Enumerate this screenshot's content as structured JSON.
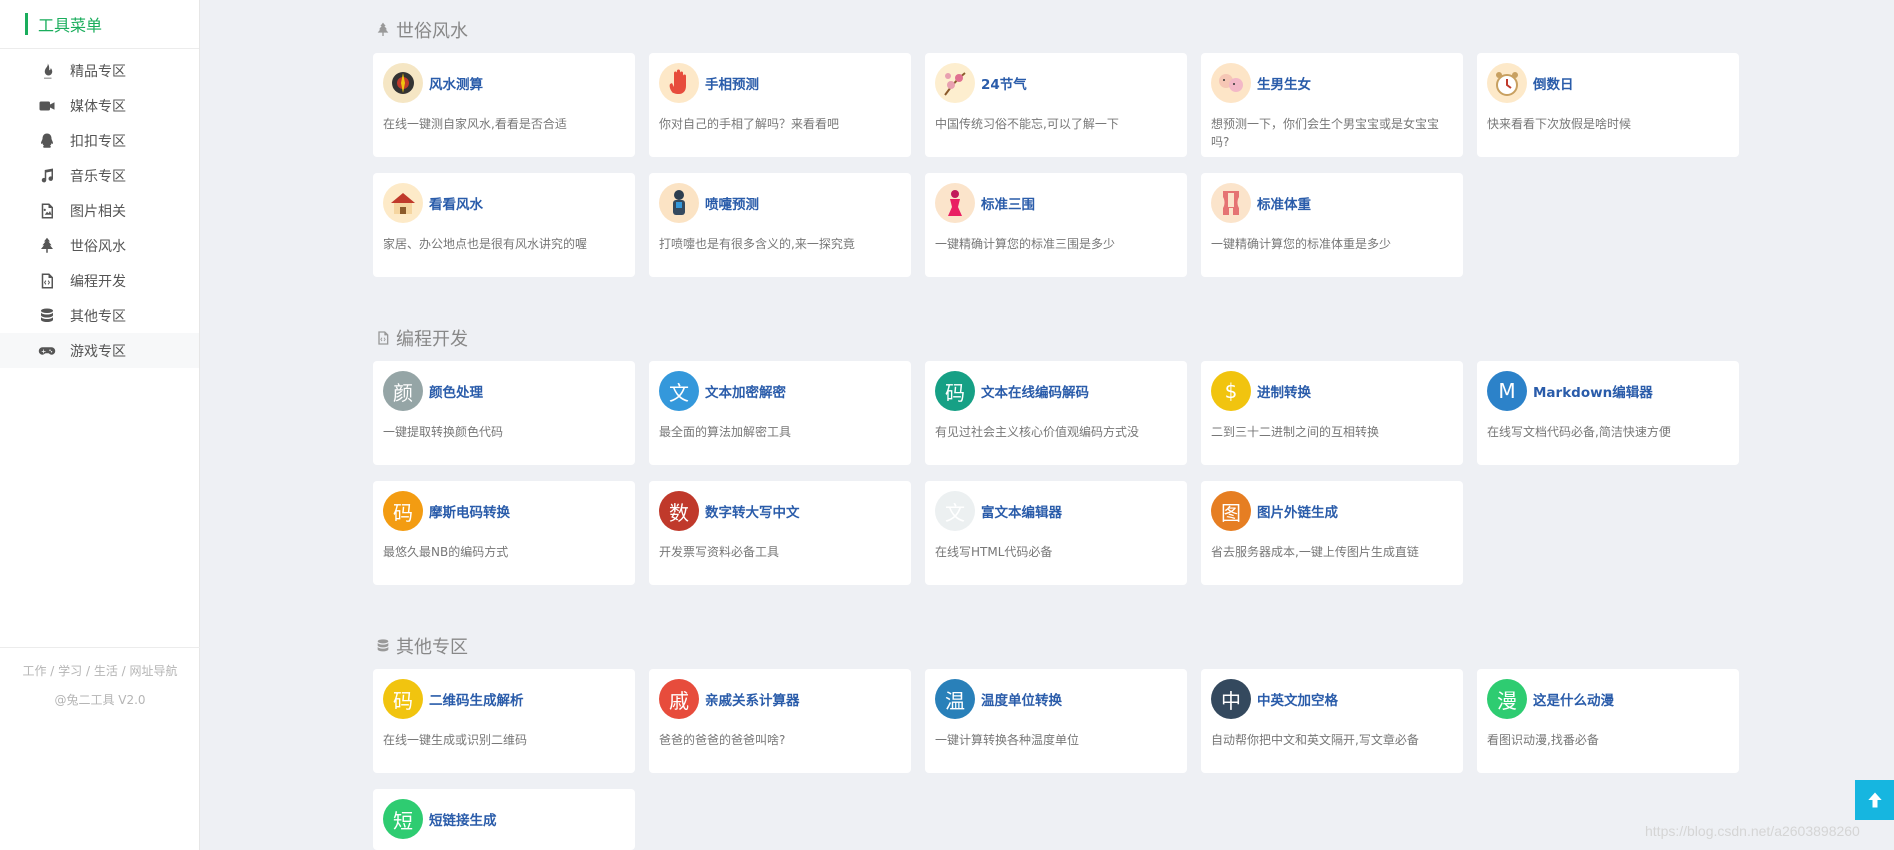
{
  "sidebar": {
    "title": "工具菜单",
    "items": [
      {
        "label": "精品专区",
        "icon": "fire-icon"
      },
      {
        "label": "媒体专区",
        "icon": "video-camera-icon"
      },
      {
        "label": "扣扣专区",
        "icon": "qq-icon"
      },
      {
        "label": "音乐专区",
        "icon": "music-note-icon"
      },
      {
        "label": "图片相关",
        "icon": "image-file-icon"
      },
      {
        "label": "世俗风水",
        "icon": "tree-icon"
      },
      {
        "label": "编程开发",
        "icon": "code-file-icon"
      },
      {
        "label": "其他专区",
        "icon": "database-icon"
      },
      {
        "label": "游戏专区",
        "icon": "gamepad-icon"
      }
    ],
    "footer": {
      "line1": "工作 / 学习 / 生活 / 网址导航",
      "line2": "@兔二工具 V2.0"
    }
  },
  "sections": [
    {
      "title": "世俗风水",
      "icon": "tree-icon",
      "cards": [
        {
          "name": "风水测算",
          "desc": "在线一键测自家风水,看看是否合适",
          "avatar_color": "#f5e6c4"
        },
        {
          "name": "手相预测",
          "desc": "你对自己的手相了解吗？来看看吧",
          "avatar_color": "#fde8c8"
        },
        {
          "name": "24节气",
          "desc": "中国传统习俗不能忘,可以了解一下",
          "avatar_color": "#fdeecf"
        },
        {
          "name": "生男生女",
          "desc": "想预测一下，你们会生个男宝宝或是女宝宝吗?",
          "avatar_color": "#fde5c7"
        },
        {
          "name": "倒数日",
          "desc": "快来看看下次放假是啥时候",
          "avatar_color": "#fde9c9"
        },
        {
          "name": "看看风水",
          "desc": "家居、办公地点也是很有风水讲究的喔",
          "avatar_color": "#fdeac8"
        },
        {
          "name": "喷嚏预测",
          "desc": "打喷嚏也是有很多含义的,来一探究竟",
          "avatar_color": "#fbe3c4"
        },
        {
          "name": "标准三围",
          "desc": "一键精确计算您的标准三围是多少",
          "avatar_color": "#fbe4cb"
        },
        {
          "name": "标准体重",
          "desc": "一键精确计算您的标准体重是多少",
          "avatar_color": "#fbe4cb"
        }
      ]
    },
    {
      "title": "编程开发",
      "icon": "code-file-icon",
      "cards": [
        {
          "name": "颜色处理",
          "desc": "一键提取转换颜色代码",
          "glyph": "颜",
          "avatar_color": "#95a5a6"
        },
        {
          "name": "文本加密解密",
          "desc": "最全面的算法加解密工具",
          "glyph": "文",
          "avatar_color": "#3498db"
        },
        {
          "name": "文本在线编码解码",
          "desc": "有见过社会主义核心价值观编码方式没",
          "glyph": "码",
          "avatar_color": "#16a085"
        },
        {
          "name": "进制转换",
          "desc": "二到三十二进制之间的互相转换",
          "glyph": "$",
          "avatar_color": "#f1c40f"
        },
        {
          "name": "Markdown编辑器",
          "desc": "在线写文档代码必备,简洁快速方便",
          "glyph": "M",
          "avatar_color": "#2c82c9"
        },
        {
          "name": "摩斯电码转换",
          "desc": "最悠久最NB的编码方式",
          "glyph": "码",
          "avatar_color": "#f39c12"
        },
        {
          "name": "数字转大写中文",
          "desc": "开发票写资料必备工具",
          "glyph": "数",
          "avatar_color": "#c0392b"
        },
        {
          "name": "富文本编辑器",
          "desc": "在线写HTML代码必备",
          "glyph": "文",
          "avatar_color": "#ecf0f1"
        },
        {
          "name": "图片外链生成",
          "desc": "省去服务器成本,一键上传图片生成直链",
          "glyph": "图",
          "avatar_color": "#e67e22"
        }
      ]
    },
    {
      "title": "其他专区",
      "icon": "database-icon",
      "cards": [
        {
          "name": "二维码生成解析",
          "desc": "在线一键生成或识别二维码",
          "glyph": "码",
          "avatar_color": "#f1c40f"
        },
        {
          "name": "亲戚关系计算器",
          "desc": "爸爸的爸爸的爸爸叫啥?",
          "glyph": "戚",
          "avatar_color": "#e74c3c"
        },
        {
          "name": "温度单位转换",
          "desc": "一键计算转换各种温度单位",
          "glyph": "温",
          "avatar_color": "#2980b9"
        },
        {
          "name": "中英文加空格",
          "desc": "自动帮你把中文和英文隔开,写文章必备",
          "glyph": "中",
          "avatar_color": "#34495e"
        },
        {
          "name": "这是什么动漫",
          "desc": "看图识动漫,找番必备",
          "glyph": "漫",
          "avatar_color": "#2ecc71"
        },
        {
          "name": "短链接生成",
          "desc": "",
          "glyph": "短",
          "avatar_color": "#2ecc71"
        }
      ]
    }
  ],
  "watermark": "https://blog.csdn.net/a2603898260",
  "float_button": {
    "icon": "arrow-up-icon"
  }
}
